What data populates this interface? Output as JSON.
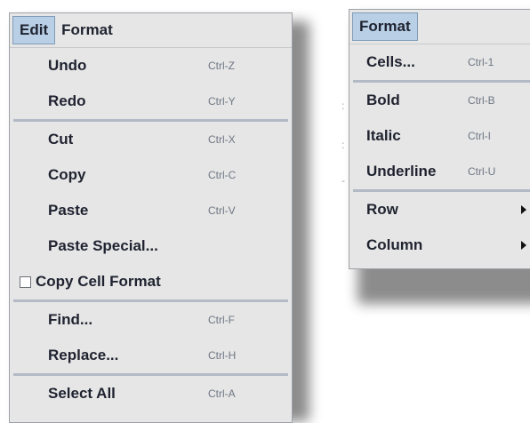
{
  "edit_menu": {
    "bar": {
      "edit": "Edit",
      "format": "Format"
    },
    "groups": [
      [
        {
          "label": "Undo",
          "shortcut": "Ctrl-Z"
        },
        {
          "label": "Redo",
          "shortcut": "Ctrl-Y"
        }
      ],
      [
        {
          "label": "Cut",
          "shortcut": "Ctrl-X"
        },
        {
          "label": "Copy",
          "shortcut": "Ctrl-C"
        },
        {
          "label": "Paste",
          "shortcut": "Ctrl-V"
        },
        {
          "label": "Paste Special..."
        },
        {
          "label": "Copy Cell Format",
          "checkbox": true,
          "checked": false
        }
      ],
      [
        {
          "label": "Find...",
          "shortcut": "Ctrl-F"
        },
        {
          "label": "Replace...",
          "shortcut": "Ctrl-H"
        }
      ],
      [
        {
          "label": "Select All",
          "shortcut": "Ctrl-A"
        }
      ]
    ]
  },
  "format_menu": {
    "bar": {
      "format": "Format"
    },
    "groups": [
      [
        {
          "label": "Cells...",
          "shortcut": "Ctrl-1"
        }
      ],
      [
        {
          "label": "Bold",
          "shortcut": "Ctrl-B"
        },
        {
          "label": "Italic",
          "shortcut": "Ctrl-I"
        },
        {
          "label": "Underline",
          "shortcut": "Ctrl-U"
        }
      ],
      [
        {
          "label": "Row",
          "submenu": true
        },
        {
          "label": "Column",
          "submenu": true
        }
      ]
    ]
  },
  "colors": {
    "menu_background": "#e6e6e6",
    "selected_menu": "#b8cfe5",
    "separator": "#b3bac5",
    "text": "#1f2330",
    "shortcut_text": "#6e7784"
  }
}
